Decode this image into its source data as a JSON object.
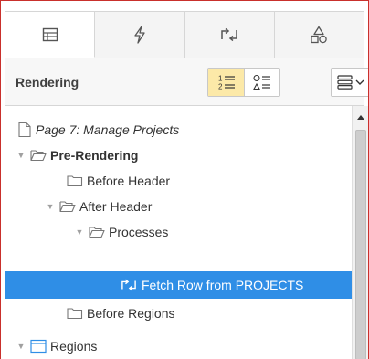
{
  "tabs": [
    {
      "icon": "panel-list-icon",
      "active": true
    },
    {
      "icon": "lightning-icon",
      "active": false
    },
    {
      "icon": "process-arrows-icon",
      "active": false
    },
    {
      "icon": "shared-components-icon",
      "active": false
    }
  ],
  "toolbar": {
    "title": "Rendering",
    "view_toggle": [
      {
        "icon": "ordered-list-icon",
        "selected": true
      },
      {
        "icon": "grouped-list-icon",
        "selected": false
      }
    ],
    "menu_icon": "menu-lines-icon"
  },
  "tree": {
    "items": [
      {
        "label": "Page 7: Manage Projects",
        "icon": "page-icon",
        "expanded": null,
        "style": "italic"
      },
      {
        "label": "Pre-Rendering",
        "icon": "folder-open-icon",
        "expanded": true,
        "style": "bold"
      },
      {
        "label": "Before Header",
        "icon": "folder-icon",
        "expanded": null,
        "style": "normal"
      },
      {
        "label": "After Header",
        "icon": "folder-open-icon",
        "expanded": true,
        "style": "normal"
      },
      {
        "label": "Processes",
        "icon": "folder-open-icon",
        "expanded": true,
        "style": "normal"
      },
      {
        "label": "Fetch Row from PROJECTS",
        "icon": "process-arrows-icon",
        "expanded": null,
        "style": "normal",
        "selected": true
      },
      {
        "label": "Before Regions",
        "icon": "folder-icon",
        "expanded": null,
        "style": "normal"
      },
      {
        "label": "Regions",
        "icon": "region-icon",
        "expanded": true,
        "style": "normal"
      }
    ]
  },
  "colors": {
    "selected_bg": "#2f8ee6",
    "toggle_on": "#fce9a8",
    "frame_border": "#c9302c"
  }
}
